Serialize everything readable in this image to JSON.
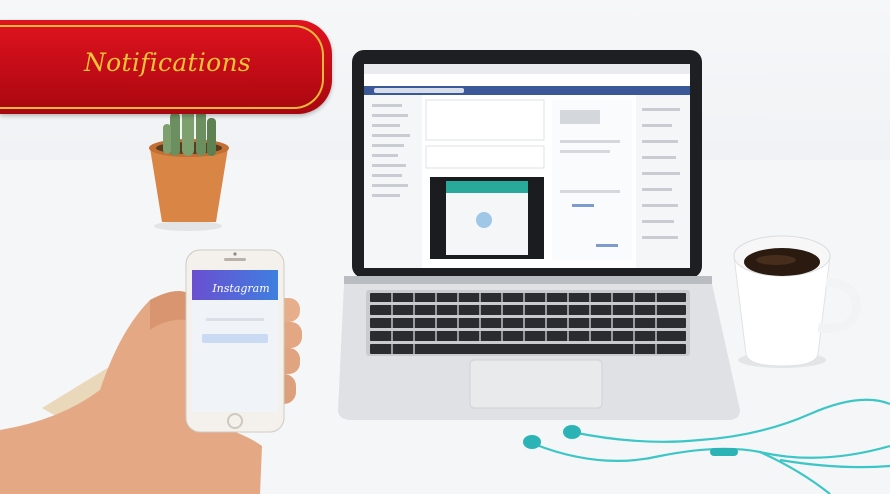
{
  "banner": {
    "title": "Notifications"
  },
  "phone": {
    "app_name": "Instagram"
  },
  "colors": {
    "banner_red": "#c70d18",
    "banner_gold": "#f3c437",
    "facebook_blue": "#3b5998",
    "instagram_blue": "#4f5fd6",
    "earphone_teal": "#3cc6c6",
    "cup_coffee": "#2a1a10",
    "pot_terracotta": "#d98545"
  },
  "icons": [
    "cactus-plant",
    "laptop",
    "smartphone",
    "coffee-cup",
    "earphones"
  ]
}
